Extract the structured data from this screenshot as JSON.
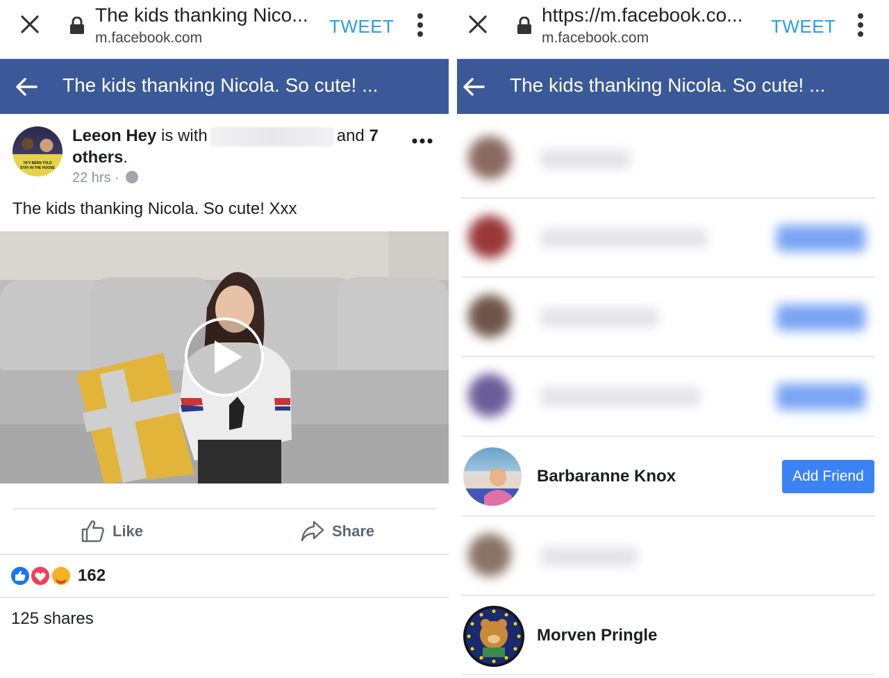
{
  "left": {
    "chrome": {
      "title": "The kids thanking Nico...",
      "domain": "m.facebook.com",
      "tweet_label": "TWEET"
    },
    "header": {
      "title": "The kids thanking Nicola. So cute! ..."
    },
    "post": {
      "author": "Leeon Hey",
      "with_text": "is with",
      "and_text": "and",
      "others_count": "7",
      "others_label": "others",
      "time": "22 hrs",
      "text": "The kids thanking Nicola. So cute! Xxx",
      "avatar_badge": "YE'V BEEN TOLD STAY IN THE HOOSE"
    },
    "actions": {
      "like_label": "Like",
      "share_label": "Share"
    },
    "reactions": {
      "count": "162"
    },
    "shares_text": "125 shares"
  },
  "right": {
    "chrome": {
      "title": "https://m.facebook.co...",
      "domain": "m.facebook.com",
      "tweet_label": "TWEET"
    },
    "header": {
      "title": "The kids thanking Nicola. So cute! ..."
    },
    "people": [
      {
        "name": "Barbaranne Knox",
        "button": "Add Friend"
      },
      {
        "name": "Morven Pringle"
      }
    ]
  },
  "colors": {
    "facebook_blue": "#3b5998",
    "tweet_blue": "#2a9ee0",
    "button_blue": "#3b82f6"
  }
}
